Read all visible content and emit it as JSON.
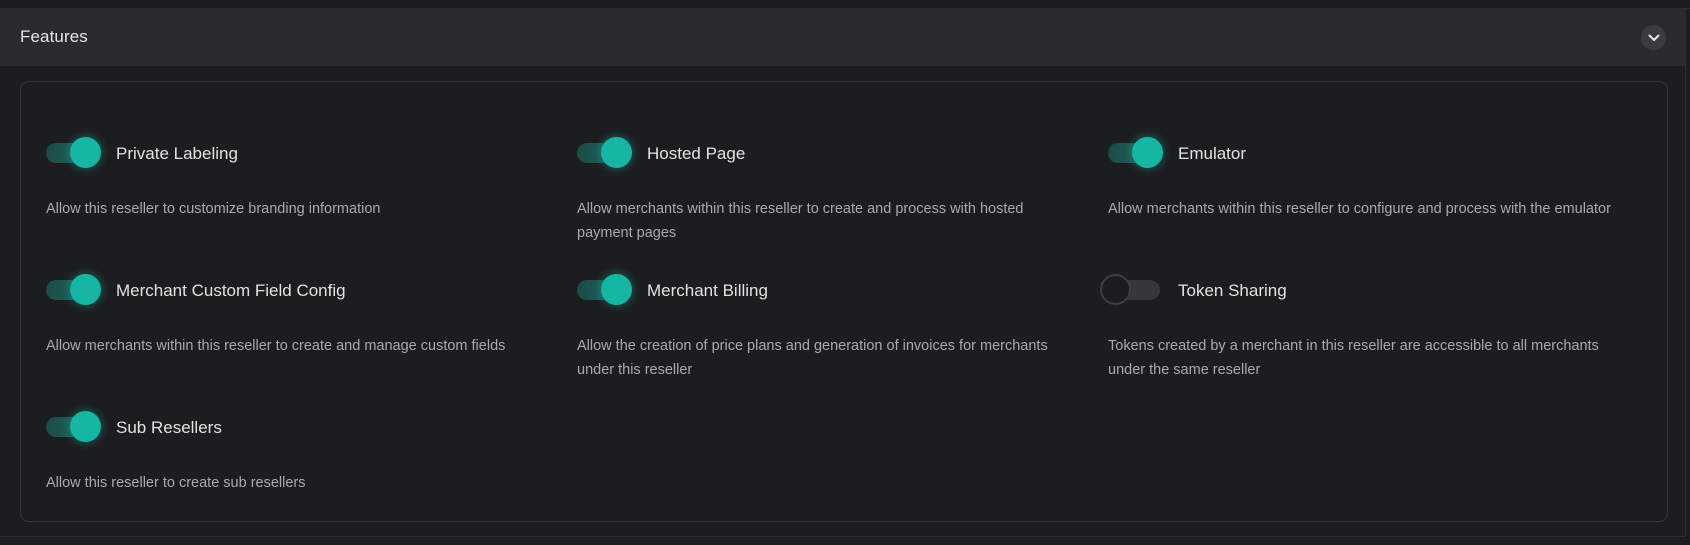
{
  "panel": {
    "title": "Features",
    "collapse_icon": "chevron-down-icon"
  },
  "colors": {
    "accent": "#17b5a3",
    "background": "#1c1d1f",
    "header_background": "#2a2b2e",
    "text_primary": "#e2e2e2",
    "text_secondary": "#a9aaad"
  },
  "features": [
    {
      "label": "Private Labeling",
      "description": "Allow this reseller to customize branding information",
      "enabled": true
    },
    {
      "label": "Hosted Page",
      "description": "Allow merchants within this reseller to create and process with hosted payment pages",
      "enabled": true
    },
    {
      "label": "Emulator",
      "description": "Allow merchants within this reseller to configure and process with the emulator",
      "enabled": true
    },
    {
      "label": "Merchant Custom Field Config",
      "description": "Allow merchants within this reseller to create and manage custom fields",
      "enabled": true
    },
    {
      "label": "Merchant Billing",
      "description": "Allow the creation of price plans and generation of invoices for merchants under this reseller",
      "enabled": true
    },
    {
      "label": "Token Sharing",
      "description": "Tokens created by a merchant in this reseller are accessible to all merchants under the same reseller",
      "enabled": false
    },
    {
      "label": "Sub Resellers",
      "description": "Allow this reseller to create sub resellers",
      "enabled": true
    }
  ]
}
